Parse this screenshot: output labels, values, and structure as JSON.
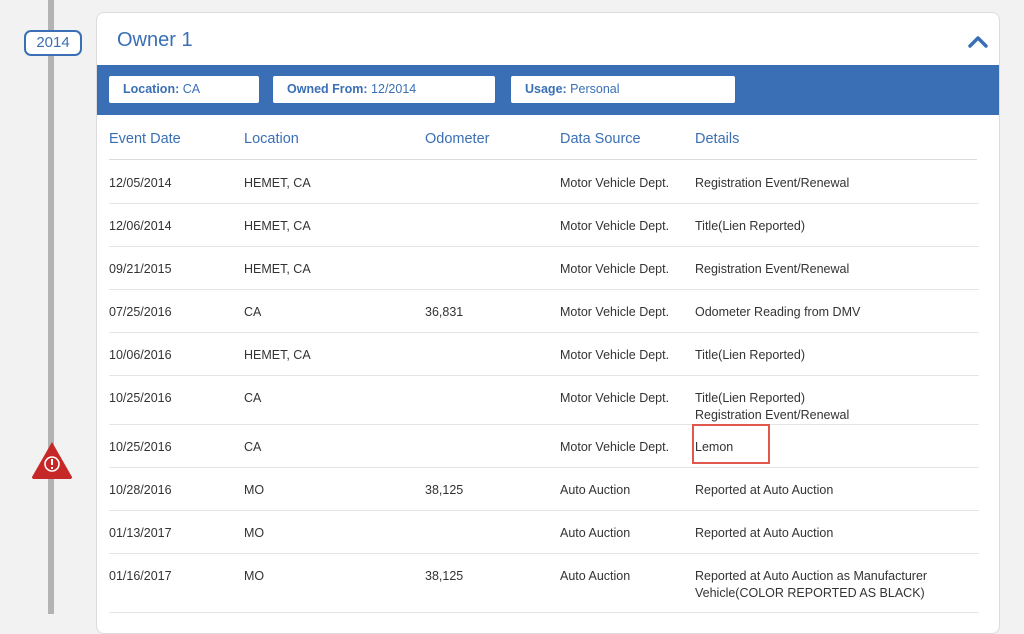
{
  "timeline": {
    "year": "2014"
  },
  "owner": {
    "title": "Owner 1",
    "location_label": "Location:",
    "location_value": "CA",
    "owned_from_label": "Owned From:",
    "owned_from_value": "12/2014",
    "usage_label": "Usage:",
    "usage_value": "Personal"
  },
  "table": {
    "headers": [
      "Event Date",
      "Location",
      "Odometer",
      "Data Source",
      "Details"
    ],
    "rows": [
      {
        "date": "12/05/2014",
        "location": "HEMET, CA",
        "odometer": "",
        "source": "Motor Vehicle Dept.",
        "details": [
          "Registration Event/Renewal"
        ]
      },
      {
        "date": "12/06/2014",
        "location": "HEMET, CA",
        "odometer": "",
        "source": "Motor Vehicle Dept.",
        "details": [
          "Title(Lien Reported)"
        ]
      },
      {
        "date": "09/21/2015",
        "location": "HEMET, CA",
        "odometer": "",
        "source": "Motor Vehicle Dept.",
        "details": [
          "Registration Event/Renewal"
        ]
      },
      {
        "date": "07/25/2016",
        "location": "CA",
        "odometer": "36,831",
        "source": "Motor Vehicle Dept.",
        "details": [
          "Odometer Reading from DMV"
        ]
      },
      {
        "date": "10/06/2016",
        "location": "HEMET, CA",
        "odometer": "",
        "source": "Motor Vehicle Dept.",
        "details": [
          "Title(Lien Reported)"
        ]
      },
      {
        "date": "10/25/2016",
        "location": "CA",
        "odometer": "",
        "source": "Motor Vehicle Dept.",
        "details": [
          "Title(Lien Reported)",
          "Registration Event/Renewal"
        ]
      },
      {
        "date": "10/25/2016",
        "location": "CA",
        "odometer": "",
        "source": "Motor Vehicle Dept.",
        "details": [
          "Lemon"
        ]
      },
      {
        "date": "10/28/2016",
        "location": "MO",
        "odometer": "38,125",
        "source": "Auto Auction",
        "details": [
          "Reported at Auto Auction"
        ]
      },
      {
        "date": "01/13/2017",
        "location": "MO",
        "odometer": "",
        "source": "Auto Auction",
        "details": [
          "Reported at Auto Auction"
        ]
      },
      {
        "date": "01/16/2017",
        "location": "MO",
        "odometer": "38,125",
        "source": "Auto Auction",
        "details": [
          "Reported at Auto Auction as Manufacturer",
          "Vehicle(COLOR REPORTED AS BLACK)"
        ]
      }
    ]
  },
  "colors": {
    "accent": "#3a6fb5",
    "alert": "#c62828",
    "highlight": "#e0584c"
  }
}
